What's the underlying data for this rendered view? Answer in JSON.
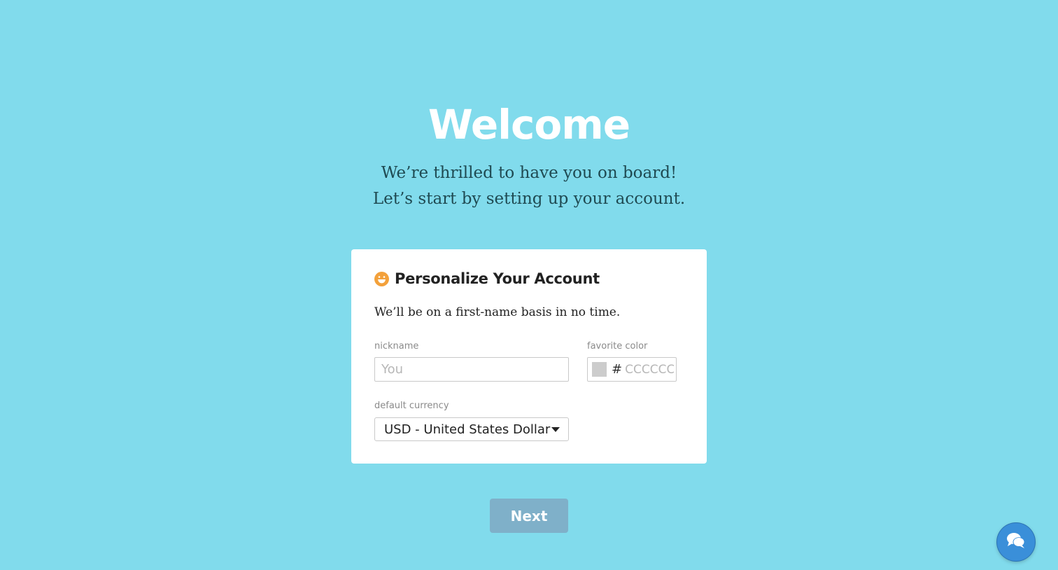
{
  "hero": {
    "title": "Welcome",
    "subtitle_line1": "We’re thrilled to have you on board!",
    "subtitle_line2": "Let’s start by setting up your account."
  },
  "card": {
    "icon": "smile-icon",
    "title": "Personalize Your Account",
    "description": "We’ll be on a first-name basis in no time.",
    "nickname": {
      "label": "nickname",
      "value": "",
      "placeholder": "You"
    },
    "favorite_color": {
      "label": "favorite color",
      "prefix": "#",
      "value": "",
      "placeholder": "CCCCCC",
      "swatch_color": "#cccccc"
    },
    "currency": {
      "label": "default currency",
      "selected": "USD - United States Dollar"
    }
  },
  "actions": {
    "next_label": "Next"
  },
  "chat": {
    "icon": "chat-bubbles-icon"
  },
  "colors": {
    "background": "#81dbec",
    "button_disabled": "#7fb0c9",
    "accent_icon": "#f3a13b",
    "chat_button": "#3a8fd9"
  }
}
